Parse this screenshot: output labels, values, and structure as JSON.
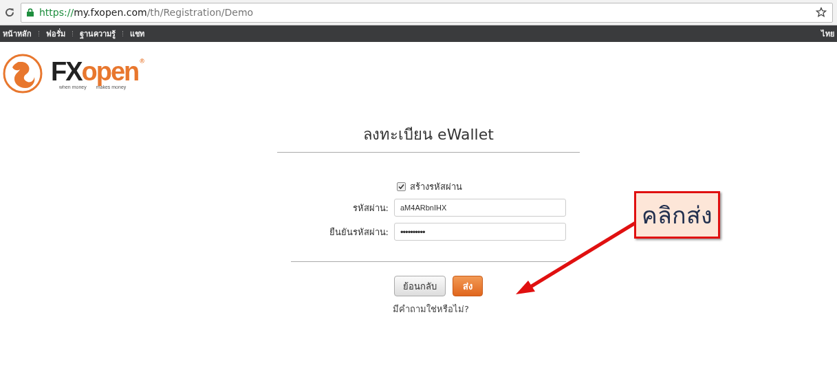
{
  "browser": {
    "url_scheme": "https://",
    "url_host": "my.fxopen.com",
    "url_path": "/th/Registration/Demo"
  },
  "nav": {
    "items": [
      {
        "label": "หน้าหลัก"
      },
      {
        "label": "ฟอรั่ม"
      },
      {
        "label": "ฐานความรู้"
      },
      {
        "label": "แชท"
      }
    ],
    "language": "ไทย"
  },
  "logo": {
    "brand_dark": "FX",
    "brand_orange": "open",
    "registered": "®",
    "tagline_left": "when money",
    "tagline_right": "makes money"
  },
  "form": {
    "title": "ลงทะเบียน eWallet",
    "generate_password": {
      "label": "สร้างรหัสผ่าน",
      "checked": true
    },
    "fields": [
      {
        "label": "รหัสผ่าน:",
        "value": "aM4ARbnIHX",
        "kind": "text"
      },
      {
        "label": "ยืนยันรหัสผ่าน:",
        "value": "••••••••••",
        "kind": "password"
      }
    ],
    "buttons": [
      {
        "label": "ย้อนกลับ",
        "kind": "default"
      },
      {
        "label": "ส่ง",
        "kind": "primary"
      }
    ],
    "help_link": "มีคำถามใช่หรือไม่?"
  },
  "annotation": {
    "text": "คลิกส่ง"
  }
}
